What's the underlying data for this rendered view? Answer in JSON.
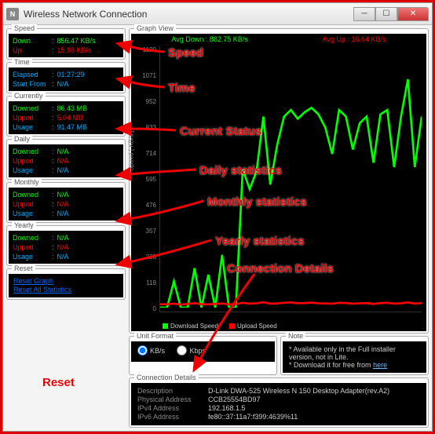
{
  "window": {
    "title": "Wireless Network Connection"
  },
  "speed": {
    "title": "Speed",
    "down_label": "Down",
    "down_value": "856.47 KB/s",
    "up_label": "Up",
    "up_value": "15.98 KB/s"
  },
  "time": {
    "title": "Time",
    "elapsed_label": "Elapsed",
    "elapsed_value": "01:27:29",
    "start_label": "Start From",
    "start_value": "N/A"
  },
  "currently": {
    "title": "Currently",
    "downed_label": "Downed",
    "downed_value": "86.43 MB",
    "upped_label": "Upped",
    "upped_value": "5.04 MB",
    "usage_label": "Usage",
    "usage_value": "91.47 MB"
  },
  "daily": {
    "title": "Daily",
    "downed_label": "Downed",
    "downed_value": "N/A",
    "upped_label": "Upped",
    "upped_value": "N/A",
    "usage_label": "Usage",
    "usage_value": "N/A"
  },
  "monthly": {
    "title": "Monthly",
    "downed_label": "Downed",
    "downed_value": "N/A",
    "upped_label": "Upped",
    "upped_value": "N/A",
    "usage_label": "Usage",
    "usage_value": "N/A"
  },
  "yearly": {
    "title": "Yearly",
    "downed_label": "Downed",
    "downed_value": "N/A",
    "upped_label": "Upped",
    "upped_value": "N/A",
    "usage_label": "Usage",
    "usage_value": "N/A"
  },
  "reset": {
    "title": "Reset",
    "reset_graph": "Reset Graph",
    "reset_all": "Reset All Statistics"
  },
  "graph": {
    "title": "Graph View",
    "avg_down_label": "Avg Down :",
    "avg_down_value": "882.75 KB/s",
    "avg_up_label": "Avg Up :",
    "avg_up_value": "16.64 KB/s",
    "ylabel": "Speed [ KB/s ]",
    "yticks": [
      "1190",
      "1071",
      "952",
      "833",
      "714",
      "595",
      "476",
      "357",
      "238",
      "119",
      "0"
    ],
    "legend_down": "Download Speed",
    "legend_up": "Upload Speed"
  },
  "unit": {
    "title": "Unit Format",
    "kbs": "KB/s",
    "kbps": "Kbps"
  },
  "note": {
    "title": "Note",
    "line1": "Available only in the Full installer version, not in Lite.",
    "line2a": "Download it for free from ",
    "line2b": "here"
  },
  "conn": {
    "title": "Connection Details",
    "desc_label": "Description",
    "desc_value": "D-Link DWA-525 Wireless N 150 Desktop Adapter(rev.A2)",
    "phys_label": "Physical Address",
    "phys_value": "CCB25554BD97",
    "ipv4_label": "IPv4 Address",
    "ipv4_value": "192.168.1.5",
    "ipv6_label": "IPv6 Address",
    "ipv6_value": "fe80::37:11a7:f399:4639%11"
  },
  "annotations": {
    "speed": "Speed",
    "time": "Time",
    "current": "Current Status",
    "daily": "Daily statistics",
    "monthly": "Monthly statistics",
    "yearly": "Yearly statistics",
    "conn": "Connection Details",
    "reset": "Reset"
  },
  "chart_data": {
    "type": "line",
    "ylabel": "Speed [ KB/s ]",
    "ylim": [
      0,
      1190
    ],
    "series": [
      {
        "name": "Download Speed",
        "color": "#00ff00",
        "values": [
          0,
          0,
          120,
          0,
          0,
          180,
          0,
          150,
          0,
          240,
          0,
          0,
          630,
          540,
          620,
          870,
          560,
          740,
          870,
          900,
          860,
          890,
          910,
          880,
          820,
          700,
          900,
          870,
          720,
          840,
          870,
          660,
          880,
          900,
          640,
          870,
          1040,
          640,
          870
        ]
      },
      {
        "name": "Upload Speed",
        "color": "#ff0000",
        "values": [
          15,
          16,
          18,
          14,
          17,
          20,
          16,
          15,
          17,
          19,
          15,
          16,
          22,
          18,
          20,
          25,
          18,
          19,
          22,
          24,
          20,
          21,
          23,
          20,
          19,
          18,
          22,
          21,
          18,
          20,
          21,
          17,
          21,
          22,
          18,
          20,
          24,
          18,
          21
        ]
      }
    ]
  }
}
